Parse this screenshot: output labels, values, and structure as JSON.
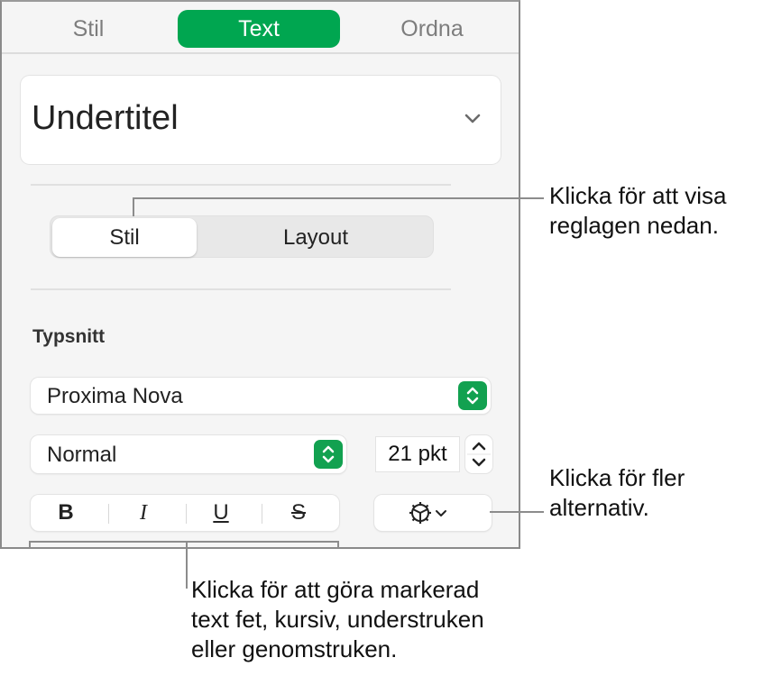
{
  "tabs": [
    {
      "label": "Stil",
      "active": false
    },
    {
      "label": "Text",
      "active": true
    },
    {
      "label": "Ordna",
      "active": false
    }
  ],
  "paragraph_style": {
    "value": "Undertitel",
    "icon": "chevron-down-icon"
  },
  "segmented": [
    {
      "label": "Stil",
      "active": true
    },
    {
      "label": "Layout",
      "active": false
    }
  ],
  "font_section": {
    "label": "Typsnitt",
    "font_family": "Proxima Nova",
    "font_style": "Normal",
    "font_size": "21 pkt"
  },
  "format_buttons": [
    {
      "label": "B",
      "name": "bold"
    },
    {
      "label": "I",
      "name": "italic"
    },
    {
      "label": "U",
      "name": "underline"
    },
    {
      "label": "S",
      "name": "strikethrough"
    }
  ],
  "more_options": {
    "icon": "gear-icon"
  },
  "callouts": {
    "segmented": [
      "Klicka för att visa",
      "reglagen nedan."
    ],
    "more_options": [
      "Klicka för fler",
      "alternativ."
    ],
    "format": [
      "Klicka för att göra markerad",
      "text fet, kursiv, understruken",
      "eller genomstruken."
    ]
  },
  "colors": {
    "accent": "#00a650"
  }
}
